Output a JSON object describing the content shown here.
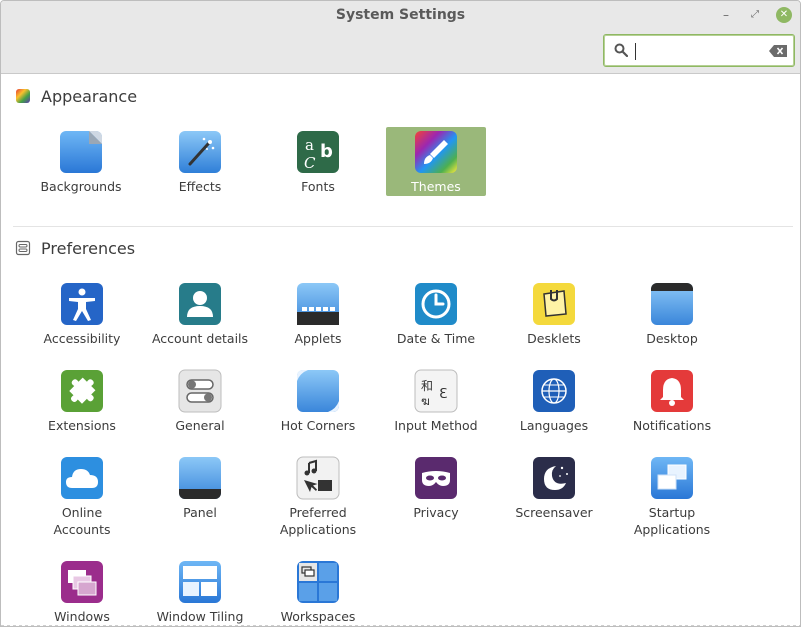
{
  "window": {
    "title": "System Settings",
    "min_glyph": "–",
    "max_glyph": "⤢",
    "close_glyph": "✕"
  },
  "search": {
    "value": "",
    "placeholder": ""
  },
  "sections": {
    "appearance": {
      "title": "Appearance",
      "items": [
        {
          "label": "Backgrounds",
          "icon": "backgrounds-icon"
        },
        {
          "label": "Effects",
          "icon": "effects-icon"
        },
        {
          "label": "Fonts",
          "icon": "fonts-icon"
        },
        {
          "label": "Themes",
          "icon": "themes-icon",
          "selected": true
        }
      ]
    },
    "preferences": {
      "title": "Preferences",
      "items": [
        {
          "label": "Accessibility",
          "icon": "accessibility-icon"
        },
        {
          "label": "Account details",
          "icon": "account-details-icon"
        },
        {
          "label": "Applets",
          "icon": "applets-icon"
        },
        {
          "label": "Date & Time",
          "icon": "clock-icon"
        },
        {
          "label": "Desklets",
          "icon": "desklets-icon"
        },
        {
          "label": "Desktop",
          "icon": "desktop-icon"
        },
        {
          "label": "Extensions",
          "icon": "puzzle-icon"
        },
        {
          "label": "General",
          "icon": "toggles-icon"
        },
        {
          "label": "Hot Corners",
          "icon": "hot-corners-icon"
        },
        {
          "label": "Input Method",
          "icon": "input-method-icon"
        },
        {
          "label": "Languages",
          "icon": "globe-icon"
        },
        {
          "label": "Notifications",
          "icon": "bell-icon"
        },
        {
          "label": "Online Accounts",
          "icon": "cloud-icon"
        },
        {
          "label": "Panel",
          "icon": "panel-icon"
        },
        {
          "label": "Preferred Applications",
          "label_lines": [
            "Preferred",
            "Applications"
          ],
          "icon": "preferred-apps-icon"
        },
        {
          "label": "Privacy",
          "icon": "mask-icon"
        },
        {
          "label": "Screensaver",
          "icon": "moon-icon"
        },
        {
          "label": "Startup Applications",
          "label_lines": [
            "Startup",
            "Applications"
          ],
          "icon": "startup-apps-icon"
        },
        {
          "label": "Windows",
          "icon": "windows-icon"
        },
        {
          "label": "Window Tiling",
          "icon": "window-tiling-icon"
        },
        {
          "label": "Workspaces",
          "icon": "workspaces-icon"
        }
      ]
    }
  },
  "colors": {
    "accent": "#8fb863",
    "selected_tile": "#9ab87a"
  }
}
